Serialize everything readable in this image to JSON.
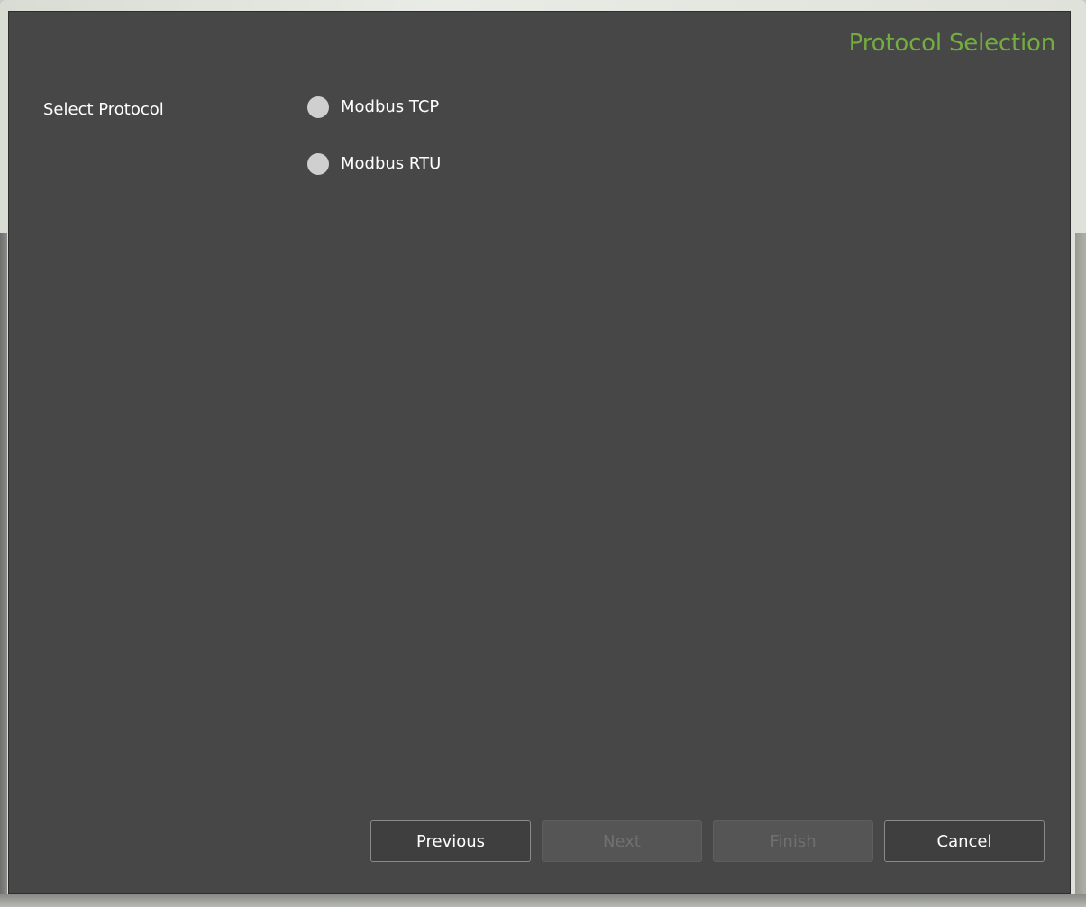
{
  "wizard": {
    "title": "Protocol Selection",
    "field_label": "Select Protocol",
    "options": [
      {
        "label": "Modbus TCP",
        "selected": false
      },
      {
        "label": "Modbus RTU",
        "selected": false
      }
    ]
  },
  "buttons": {
    "previous": {
      "label": "Previous",
      "enabled": true
    },
    "next": {
      "label": "Next",
      "enabled": false
    },
    "finish": {
      "label": "Finish",
      "enabled": false
    },
    "cancel": {
      "label": "Cancel",
      "enabled": true
    }
  },
  "colors": {
    "title_accent": "#72ad3f",
    "panel_background": "#474747",
    "radio_fill": "#cfcfcf"
  }
}
